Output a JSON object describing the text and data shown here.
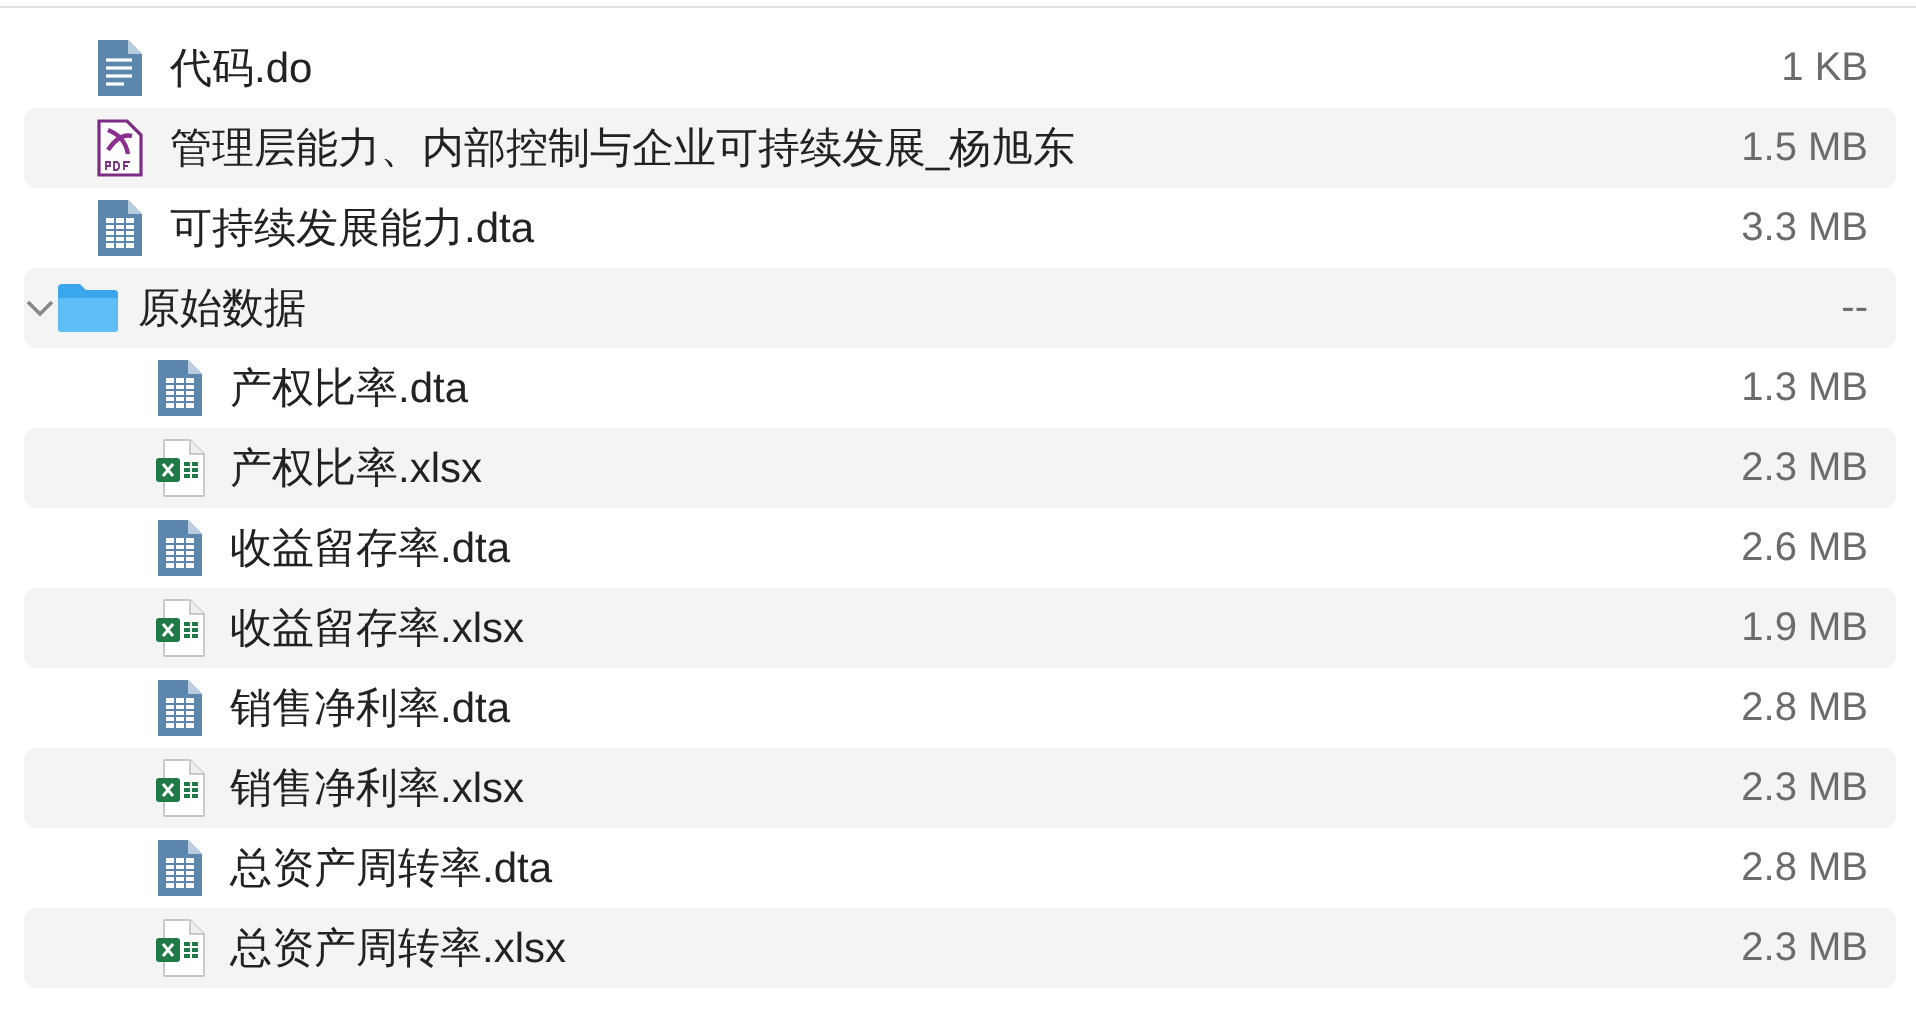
{
  "files": [
    {
      "kind": "doc",
      "name": "代码.do",
      "size": "1 KB"
    },
    {
      "kind": "pdf",
      "name": "管理层能力、内部控制与企业可持续发展_杨旭东",
      "size": "1.5 MB"
    },
    {
      "kind": "dta",
      "name": "可持续发展能力.dta",
      "size": "3.3 MB"
    },
    {
      "kind": "folder",
      "name": "原始数据",
      "size": "--",
      "expanded": true,
      "children": [
        {
          "kind": "dta",
          "name": "产权比率.dta",
          "size": "1.3 MB"
        },
        {
          "kind": "xlsx",
          "name": "产权比率.xlsx",
          "size": "2.3 MB"
        },
        {
          "kind": "dta",
          "name": "收益留存率.dta",
          "size": "2.6 MB"
        },
        {
          "kind": "xlsx",
          "name": "收益留存率.xlsx",
          "size": "1.9 MB"
        },
        {
          "kind": "dta",
          "name": "销售净利率.dta",
          "size": "2.8 MB"
        },
        {
          "kind": "xlsx",
          "name": "销售净利率.xlsx",
          "size": "2.3 MB"
        },
        {
          "kind": "dta",
          "name": "总资产周转率.dta",
          "size": "2.8 MB"
        },
        {
          "kind": "xlsx",
          "name": "总资产周转率.xlsx",
          "size": "2.3 MB"
        }
      ]
    }
  ]
}
